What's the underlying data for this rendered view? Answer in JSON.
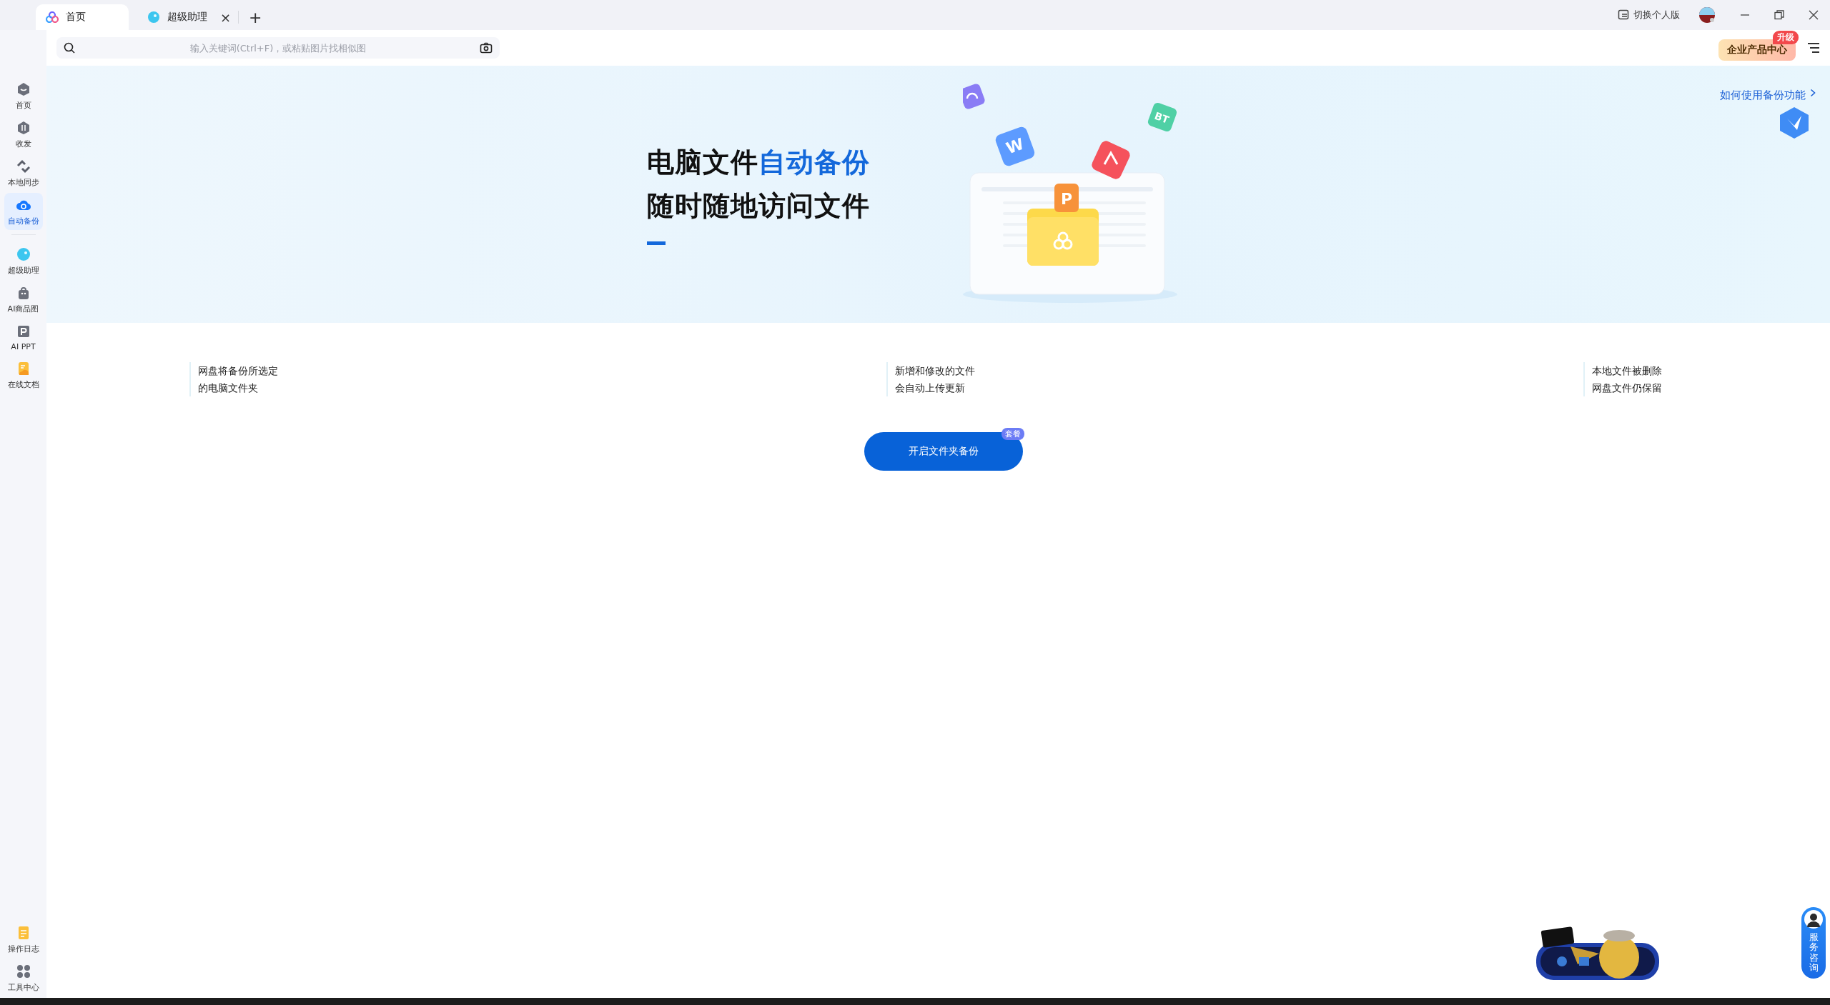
{
  "tabs": [
    {
      "label": "首页",
      "selected": true
    },
    {
      "label": "超级助理",
      "selected": false,
      "close": "×"
    }
  ],
  "new_tab": "+",
  "title_bar": {
    "switch_label": "切换个人版"
  },
  "search": {
    "placeholder": "输入关键词(Ctrl+F)，或粘贴图片找相似图"
  },
  "enterprise_button": {
    "label": "企业产品中心",
    "badge": "升级"
  },
  "sidebar": {
    "items": [
      {
        "label": "首页",
        "selected": false
      },
      {
        "label": "收发",
        "selected": false
      },
      {
        "label": "本地同步",
        "selected": false
      },
      {
        "label": "自动备份",
        "selected": true
      },
      {
        "label": "超级助理",
        "selected": false
      },
      {
        "label": "AI商品图",
        "selected": false
      },
      {
        "label": "AI PPT",
        "selected": false
      },
      {
        "label": "在线文档",
        "selected": false
      }
    ],
    "bottom_items": [
      {
        "label": "操作日志"
      },
      {
        "label": "工具中心"
      }
    ]
  },
  "banner": {
    "title_plain": "电脑文件",
    "title_highlight": "自动备份",
    "subtitle": "随时随地访问文件",
    "help_link": "如何使用备份功能",
    "file_badges": [
      "W",
      "BT",
      "P"
    ]
  },
  "features": [
    {
      "lines": [
        "网盘将备份所选定",
        "的电脑文件夹"
      ]
    },
    {
      "lines": [
        "新增和修改的文件",
        "会自动上传更新"
      ]
    },
    {
      "lines": [
        "本地文件被删除",
        "网盘文件仍保留"
      ]
    }
  ],
  "start_button": {
    "label": "开启文件夹备份",
    "badge": "套餐"
  },
  "service": {
    "label": "服务咨询"
  }
}
